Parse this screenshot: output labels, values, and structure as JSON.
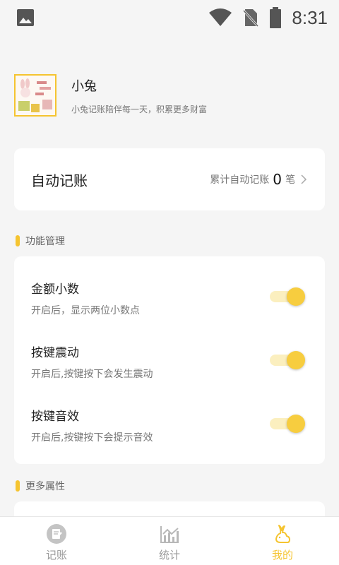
{
  "status_bar": {
    "time": "8:31"
  },
  "profile": {
    "name": "小兔",
    "motto": "小兔记账陪伴每一天，积累更多财富"
  },
  "auto_bookkeeping": {
    "title": "自动记账",
    "summary_label": "累计自动记账",
    "count": "0",
    "unit": "笔"
  },
  "sections": {
    "features": "功能管理",
    "more": "更多属性"
  },
  "settings": [
    {
      "title": "金额小数",
      "description": "开启后，显示两位小数点",
      "enabled": true
    },
    {
      "title": "按键震动",
      "description": "开启后,按键按下会发生震动",
      "enabled": true
    },
    {
      "title": "按键音效",
      "description": "开启后,按键按下会提示音效",
      "enabled": true
    }
  ],
  "bottom_nav": [
    {
      "label": "记账",
      "icon": "notebook-edit-icon",
      "active": false
    },
    {
      "label": "统计",
      "icon": "chart-icon",
      "active": false
    },
    {
      "label": "我的",
      "icon": "rabbit-icon",
      "active": true
    }
  ],
  "colors": {
    "accent": "#f5c430",
    "toggle_track": "#fbefbf",
    "background": "#f5f5f5"
  }
}
